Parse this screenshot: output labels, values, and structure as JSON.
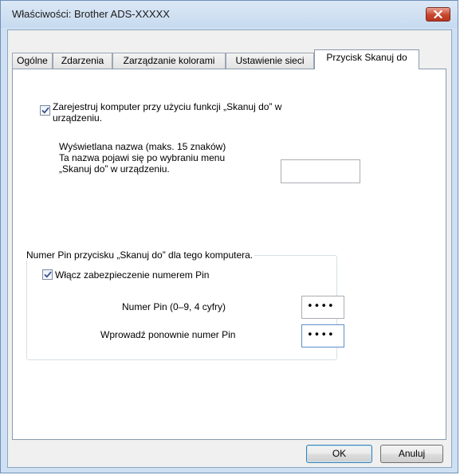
{
  "window": {
    "title": "Właściwości: Brother ADS-XXXXX",
    "close_icon": "close-icon"
  },
  "tabs": [
    {
      "label": "Ogólne",
      "active": false
    },
    {
      "label": "Zdarzenia",
      "active": false
    },
    {
      "label": "Zarządzanie kolorami",
      "active": false
    },
    {
      "label": "Ustawienie sieci",
      "active": false
    },
    {
      "label": "Przycisk Skanuj do",
      "active": true
    }
  ],
  "register": {
    "checked": true,
    "label_line1": "Zarejestruj komputer przy użyciu funkcji „Skanuj do” w",
    "label_line2": "urządzeniu."
  },
  "display_name": {
    "line1": "Wyświetlana nazwa (maks. 15 znaków)",
    "line2": "Ta nazwa pojawi się po wybraniu menu",
    "line3": "„Skanuj do” w urządzeniu.",
    "value": ""
  },
  "pin_group": {
    "legend": "Numer Pin przycisku „Skanuj do” dla tego komputera.",
    "enable_checked": true,
    "enable_label": "Włącz zabezpieczenie numerem Pin",
    "pin_label": "Numer Pin (0–9, 4 cyfry)",
    "pin_value": "••••",
    "repeat_label": "Wprowadź ponownie numer Pin",
    "repeat_value": "••••"
  },
  "buttons": {
    "ok": "OK",
    "cancel": "Anuluj"
  }
}
